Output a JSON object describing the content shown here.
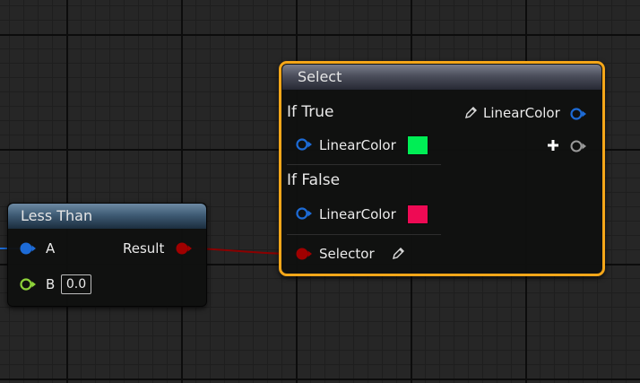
{
  "less_than": {
    "title": "Less Than",
    "input_a": "A",
    "input_b": "B",
    "input_b_value": "0.0",
    "output": "Result"
  },
  "select": {
    "title": "Select",
    "if_true": "If True",
    "if_false": "If False",
    "true_pin_label": "LinearColor",
    "false_pin_label": "LinearColor",
    "output_label": "LinearColor",
    "selector_label": "Selector",
    "true_color": "#00ee55",
    "false_color": "#ee0a54"
  },
  "colors": {
    "linear_color_pin": "#1d6bd6",
    "float_pin": "#8ed33a",
    "bool_pin": "#a00000",
    "wire": "#8a0000",
    "selection": "#f4a619"
  }
}
